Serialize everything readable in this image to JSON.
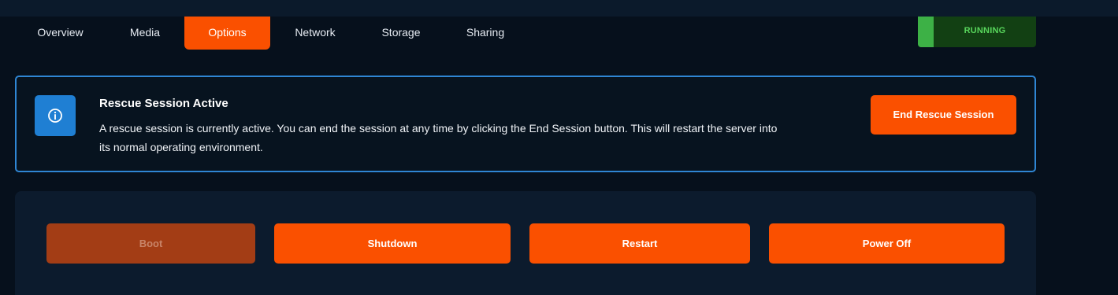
{
  "tabs": [
    {
      "label": "Overview"
    },
    {
      "label": "Media"
    },
    {
      "label": "Options",
      "active": true
    },
    {
      "label": "Network"
    },
    {
      "label": "Storage"
    },
    {
      "label": "Sharing"
    }
  ],
  "status": {
    "label": "RUNNING",
    "color": "#58d65c"
  },
  "alert": {
    "icon": "info-icon",
    "title": "Rescue Session Active",
    "message": "A rescue session is currently active. You can end the session at any time by clicking the End Session button. This will restart the server into its normal operating environment.",
    "button_label": "End Rescue Session"
  },
  "power_controls": {
    "boot_label": "Boot",
    "boot_disabled": true,
    "shutdown_label": "Shutdown",
    "restart_label": "Restart",
    "poweroff_label": "Power Off"
  },
  "colors": {
    "accent": "#fa5000",
    "info": "#1f7fd3",
    "background": "#06101c"
  }
}
